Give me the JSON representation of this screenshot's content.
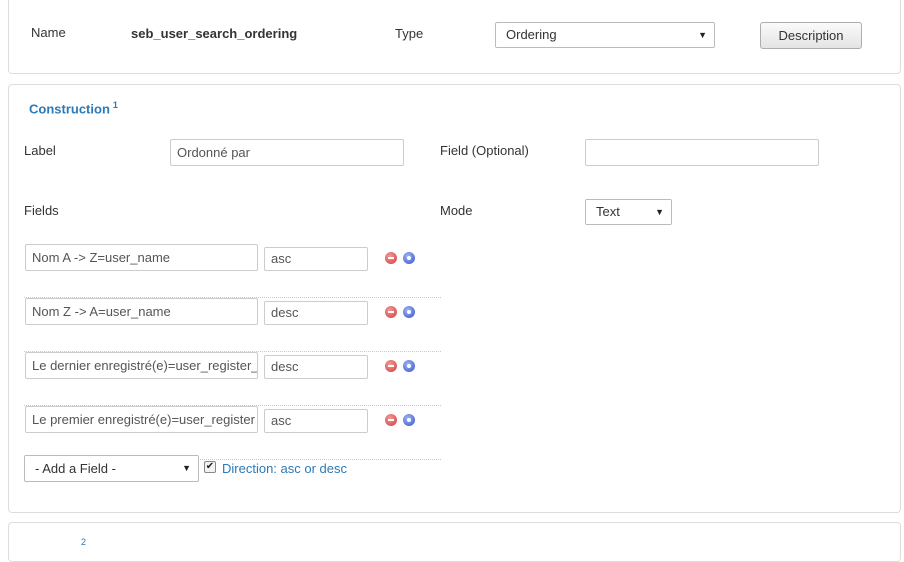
{
  "top": {
    "name_label": "Name",
    "name_value": "seb_user_search_ordering",
    "type_label": "Type",
    "type_value": "Ordering",
    "description_button": "Description"
  },
  "construction": {
    "title": "Construction",
    "title_sup": "1",
    "label_label": "Label",
    "label_value": "Ordonné par",
    "field_optional_label": "Field (Optional)",
    "field_optional_value": "",
    "fields_label": "Fields",
    "mode_label": "Mode",
    "mode_value": "Text",
    "fields": [
      {
        "name": "Nom A -> Z=user_name",
        "direction": "asc"
      },
      {
        "name": "Nom Z -> A=user_name",
        "direction": "desc"
      },
      {
        "name": "Le dernier enregistré(e)=user_register_",
        "direction": "desc"
      },
      {
        "name": "Le premier enregistré(e)=user_register",
        "direction": "asc"
      }
    ],
    "add_field_value": "- Add a Field -",
    "direction_checked": true,
    "direction_link": "Direction: asc or desc"
  },
  "next_section": {
    "title_sup": "2"
  },
  "icons": {
    "caret": "▼",
    "check": "✔"
  }
}
